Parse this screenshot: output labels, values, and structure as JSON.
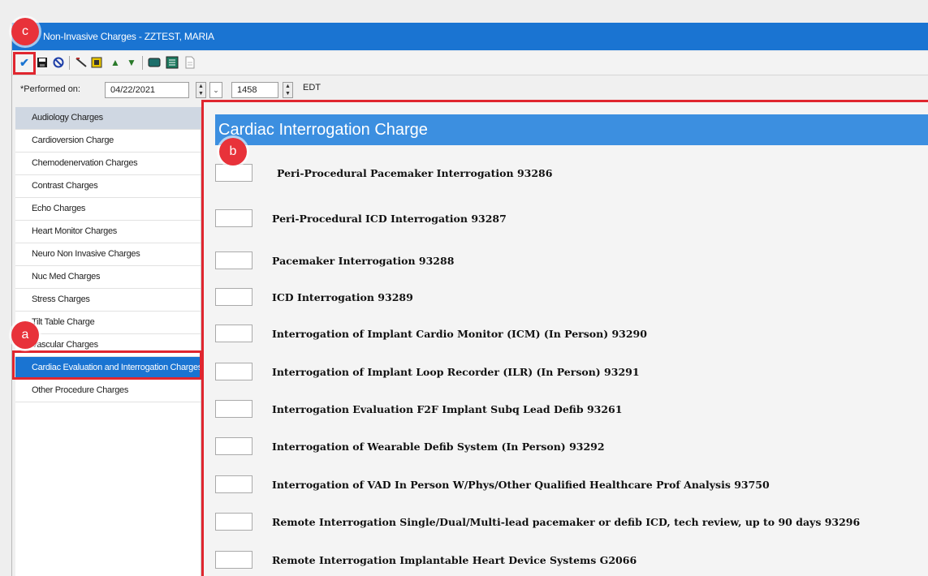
{
  "window": {
    "title": "Non-Invasive Charges - ZZTEST, MARIA"
  },
  "toolbar": {
    "icons": [
      "checkmark-icon",
      "save-icon",
      "cancel-icon",
      "edit-icon",
      "document-icon",
      "arrow-up-icon",
      "arrow-down-icon",
      "monitor-icon",
      "form-icon",
      "page-icon"
    ]
  },
  "performed": {
    "label": "*Performed on:",
    "date": "04/22/2021",
    "time": "1458",
    "timezone": "EDT"
  },
  "sidebar": {
    "items": [
      {
        "label": "Audiology Charges"
      },
      {
        "label": "Cardioversion Charge"
      },
      {
        "label": "Chemodenervation Charges"
      },
      {
        "label": "Contrast Charges"
      },
      {
        "label": "Echo Charges"
      },
      {
        "label": "Heart Monitor Charges"
      },
      {
        "label": "Neuro Non Invasive Charges"
      },
      {
        "label": "Nuc Med Charges"
      },
      {
        "label": "Stress Charges"
      },
      {
        "label": "Tilt Table Charge"
      },
      {
        "label": "Vascular Charges"
      },
      {
        "label": "Cardiac Evaluation and Interrogation Charges"
      },
      {
        "label": "Other Procedure Charges"
      }
    ]
  },
  "main": {
    "header": "Cardiac Interrogation Charge",
    "rows": [
      {
        "label": "Peri-Procedural Pacemaker Interrogation 93286"
      },
      {
        "label": "Peri-Procedural ICD Interrogation 93287"
      },
      {
        "label": "Pacemaker Interrogation 93288"
      },
      {
        "label": "ICD Interrogation 93289"
      },
      {
        "label": "Interrogation of Implant Cardio Monitor (ICM) (In Person) 93290"
      },
      {
        "label": "Interrogation of Implant Loop Recorder (ILR) (In Person) 93291"
      },
      {
        "label": "Interrogation Evaluation F2F Implant Subq Lead Defib 93261"
      },
      {
        "label": "Interrogation of Wearable Defib System (In Person) 93292"
      },
      {
        "label": "Interrogation of VAD In Person W/Phys/Other Qualified Healthcare Prof Analysis 93750"
      },
      {
        "label": "Remote Interrogation Single/Dual/Multi-lead pacemaker or defib ICD, tech review, up to 90 days 93296"
      },
      {
        "label": "Remote Interrogation Implantable Heart Device Systems G2066"
      }
    ]
  },
  "callouts": {
    "a": "a",
    "b": "b",
    "c": "c"
  },
  "colors": {
    "accent": "#1a74d2",
    "callout": "#e8323a"
  }
}
